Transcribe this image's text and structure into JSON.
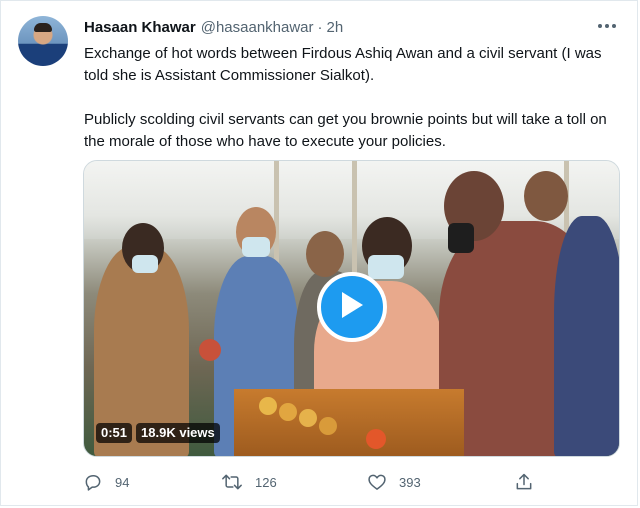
{
  "tweet": {
    "author_name": "Hasaan Khawar",
    "handle": "@hasaankhawar",
    "separator": "·",
    "time": "2h",
    "text_paragraphs": [
      "Exchange of hot words between Firdous Ashiq Awan and a civil servant (I was told she is Assistant Commissioner Sialkot).",
      "Publicly scolding civil servants can get you brownie points but will take a toll on the morale of those who have to execute your policies."
    ]
  },
  "media": {
    "duration": "0:51",
    "views": "18.9K views",
    "play_icon": "play-icon"
  },
  "actions": {
    "reply_count": "94",
    "retweet_count": "126",
    "like_count": "393",
    "icons": [
      "reply-icon",
      "retweet-icon",
      "like-icon",
      "share-icon"
    ]
  },
  "colors": {
    "accent": "#1d9bf0",
    "text": "#0f1419",
    "secondary": "#536471"
  }
}
